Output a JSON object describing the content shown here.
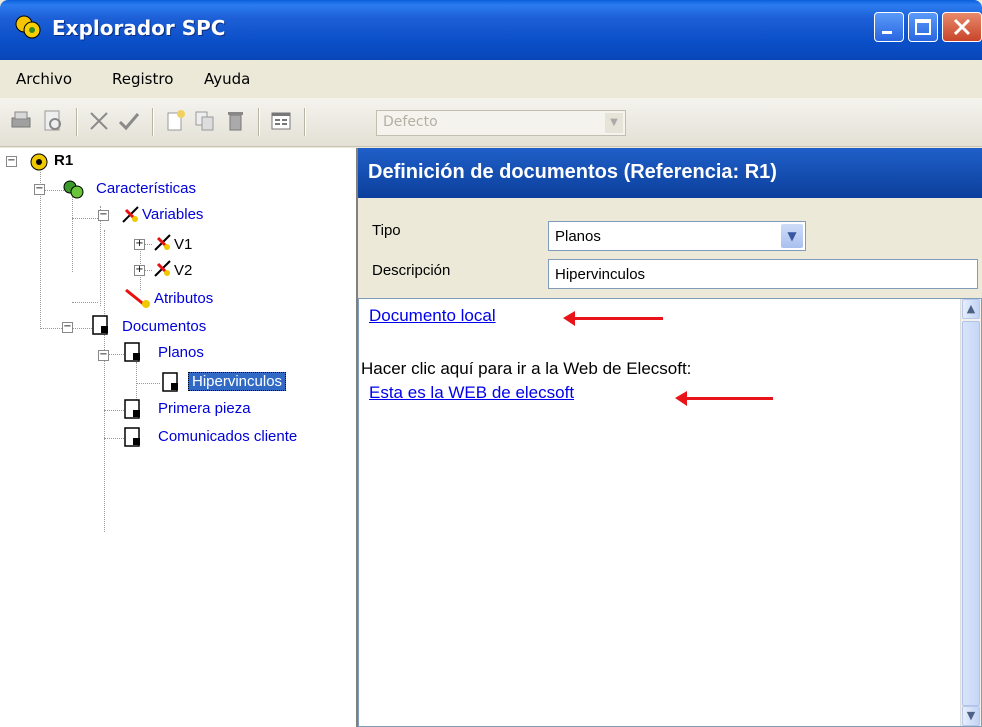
{
  "window": {
    "title": "Explorador SPC"
  },
  "menu": {
    "items": [
      "Archivo",
      "Registro",
      "Ayuda"
    ]
  },
  "toolbar": {
    "icons": [
      "print-icon",
      "print-preview-icon",
      "cut-icon",
      "check-icon",
      "new-document-icon",
      "copy-icon",
      "delete-icon",
      "form-view-icon"
    ],
    "combo_value": "Defecto"
  },
  "tree": {
    "root": "R1",
    "caracteristicas": "Características",
    "variables": "Variables",
    "v1": "V1",
    "v2": "V2",
    "atributos": "Atributos",
    "documentos": "Documentos",
    "planos": "Planos",
    "hipervinculos": "Hipervinculos",
    "primera_pieza": "Primera pieza",
    "comunicados": "Comunicados cliente"
  },
  "panel": {
    "header": "Definición de documentos (Referencia: R1)",
    "tipo_label": "Tipo",
    "tipo_value": "Planos",
    "descripcion_label": "Descripción",
    "descripcion_value": "Hipervinculos"
  },
  "document": {
    "link_local": "Documento local",
    "text": "Hacer clic aquí para ir a la Web de Elecsoft:",
    "link_web": "Esta es la WEB de elecsoft"
  },
  "colors": {
    "title_bar": "#0a4fc8",
    "header_bar": "#1f5fc8",
    "annotation_arrow": "#e8141a",
    "link": "#0000ee"
  }
}
